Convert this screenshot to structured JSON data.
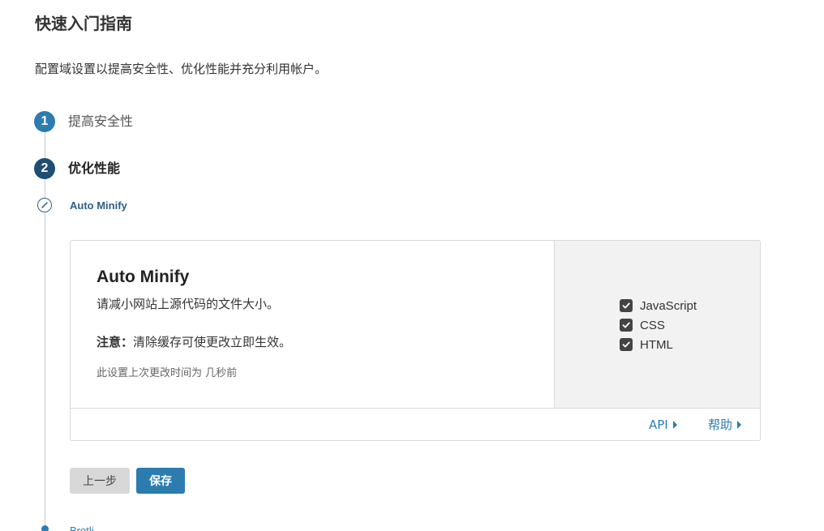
{
  "page": {
    "title": "快速入门指南",
    "subtitle": "配置域设置以提高安全性、优化性能并充分利用帐户。"
  },
  "steps": [
    {
      "number": "1",
      "label": "提高安全性",
      "state": "completed"
    },
    {
      "number": "2",
      "label": "优化性能",
      "state": "active"
    }
  ],
  "current_substep": {
    "label": "Auto Minify",
    "icon": "compass-icon"
  },
  "card": {
    "title": "Auto Minify",
    "description": "请减小网站上源代码的文件大小。",
    "note_label": "注意：",
    "note_text": "清除缓存可使更改立即生效。",
    "updated_text": "此设置上次更改时间为 几秒前",
    "options": [
      {
        "label": "JavaScript",
        "checked": true
      },
      {
        "label": "CSS",
        "checked": true
      },
      {
        "label": "HTML",
        "checked": true
      }
    ],
    "footer_links": {
      "api": "API",
      "help": "帮助"
    }
  },
  "buttons": {
    "back": "上一步",
    "save": "保存"
  },
  "next_substep": {
    "label": "Brotli"
  },
  "colors": {
    "accent": "#2c7cb0",
    "active_step": "#1f4e72",
    "panel_bg": "#f2f2f2"
  }
}
